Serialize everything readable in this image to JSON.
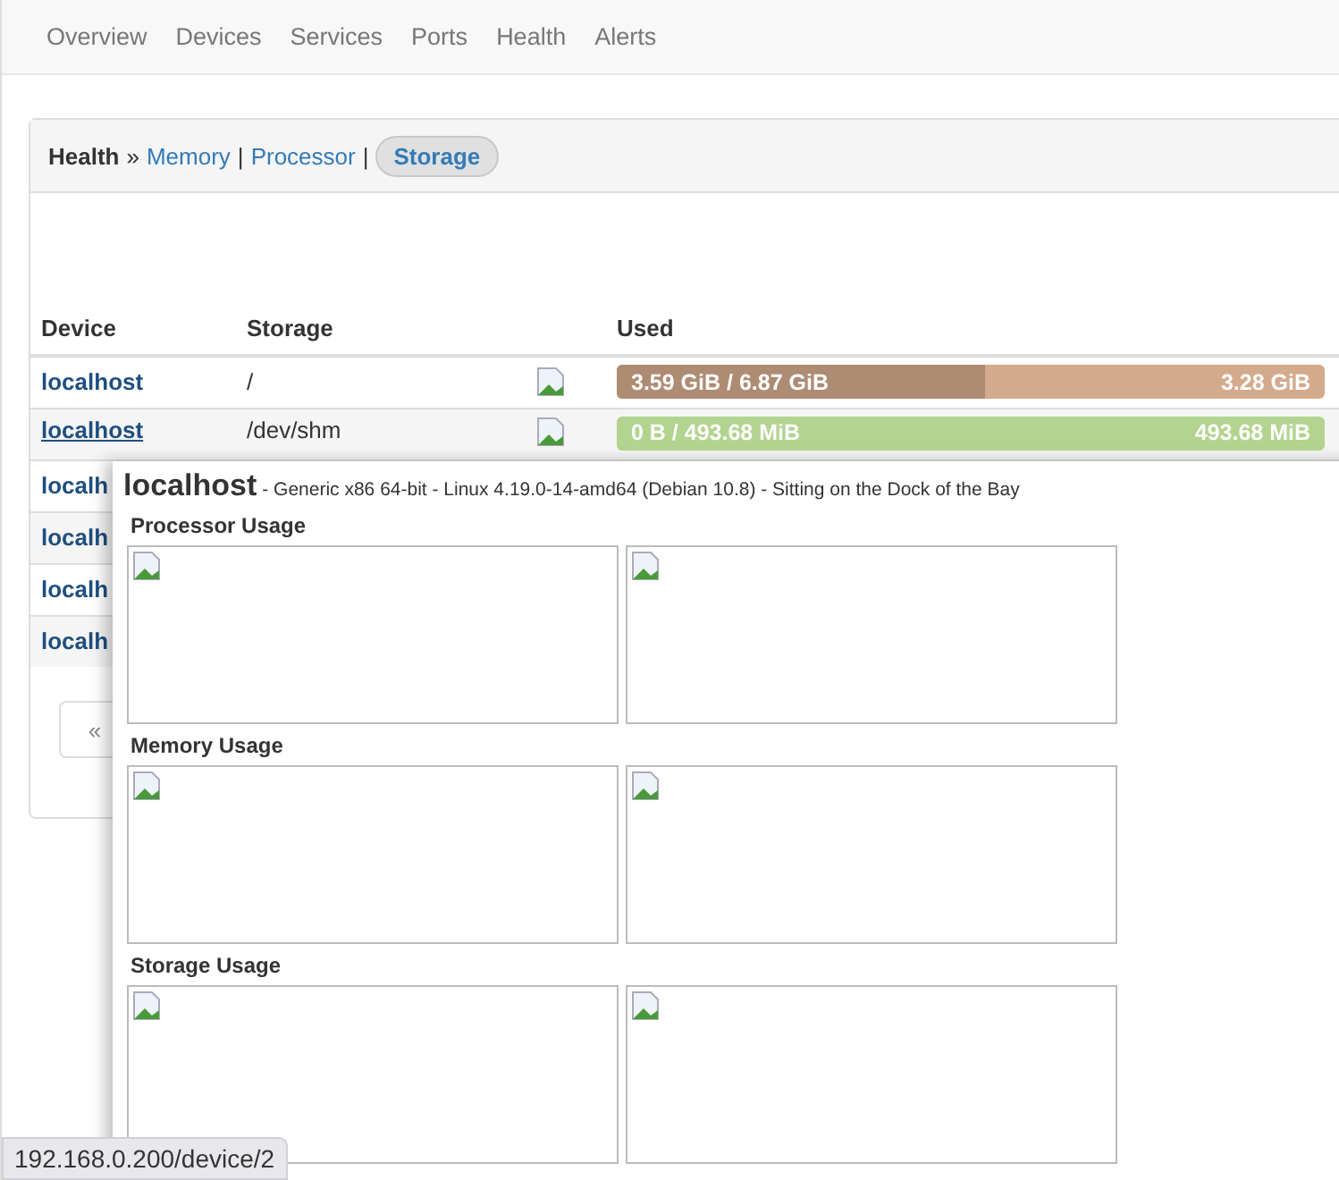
{
  "nav": {
    "items": [
      {
        "label": "Overview"
      },
      {
        "label": "Devices"
      },
      {
        "label": "Services"
      },
      {
        "label": "Ports"
      },
      {
        "label": "Health"
      },
      {
        "label": "Alerts"
      }
    ]
  },
  "panel": {
    "title": "Health",
    "separator": "»",
    "links": [
      {
        "label": "Memory",
        "selected": false
      },
      {
        "label": "Processor",
        "selected": false
      },
      {
        "label": "Storage",
        "selected": true
      }
    ],
    "link_separator": "|"
  },
  "table": {
    "columns": [
      "Device",
      "Storage",
      "Used"
    ],
    "rows": [
      {
        "device": "localhost",
        "hovered": false,
        "storage": "/",
        "used": {
          "used_label": "3.59 GiB / 6.87 GiB",
          "free_label": "3.28 GiB",
          "level": 0.52,
          "color": "#d4aa8c"
        }
      },
      {
        "device": "localhost",
        "hovered": true,
        "storage": "/dev/shm",
        "used": {
          "used_label": "0 B / 493.68 MiB",
          "free_label": "493.68 MiB",
          "level": 0,
          "color": "#b2d48e"
        }
      },
      {
        "device": "localh",
        "hovered": false
      },
      {
        "device": "localh",
        "hovered": false
      },
      {
        "device": "localh",
        "hovered": false
      },
      {
        "device": "localh",
        "hovered": false
      }
    ]
  },
  "pagination": {
    "prev": "«"
  },
  "popup": {
    "title": "localhost",
    "subtitle": "- Generic x86 64-bit - Linux 4.19.0-14-amd64 (Debian 10.8) - Sitting on the Dock of the Bay",
    "sections": [
      {
        "title": "Processor Usage"
      },
      {
        "title": "Memory Usage"
      },
      {
        "title": "Storage Usage"
      }
    ]
  },
  "status_bar": {
    "url": "192.168.0.200/device/2"
  }
}
